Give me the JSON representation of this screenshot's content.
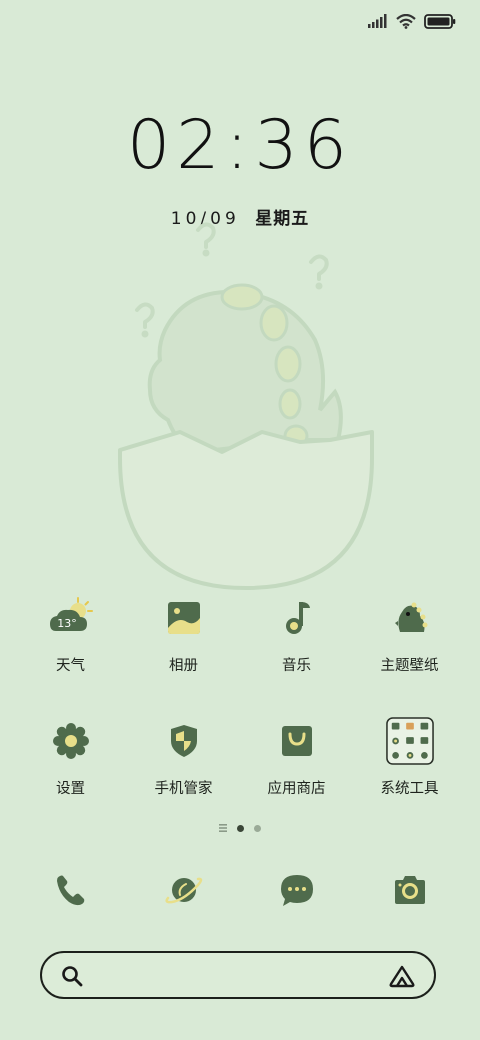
{
  "status_bar": {
    "icons": [
      "signal-icon",
      "wifi-icon",
      "battery-icon"
    ]
  },
  "lockscreen": {
    "time": "02:36",
    "date": "10/09",
    "weekday": "星期五"
  },
  "apps_row1": [
    {
      "label": "天气",
      "icon": "weather-icon",
      "temp": "13°"
    },
    {
      "label": "相册",
      "icon": "gallery-icon"
    },
    {
      "label": "音乐",
      "icon": "music-icon"
    },
    {
      "label": "主题壁纸",
      "icon": "theme-icon"
    }
  ],
  "apps_row2": [
    {
      "label": "设置",
      "icon": "settings-icon"
    },
    {
      "label": "手机管家",
      "icon": "security-icon"
    },
    {
      "label": "应用商店",
      "icon": "store-icon"
    },
    {
      "label": "系统工具",
      "icon": "tools-folder-icon"
    }
  ],
  "dock": [
    "phone-icon",
    "browser-icon",
    "messages-icon",
    "camera-icon"
  ],
  "page_indicator": {
    "pages": 2,
    "current": 1
  },
  "colors": {
    "background": "#d9ead6",
    "icon_dark": "#4f6b4c",
    "icon_accent": "#e8df8a",
    "outline": "#1d241c"
  }
}
